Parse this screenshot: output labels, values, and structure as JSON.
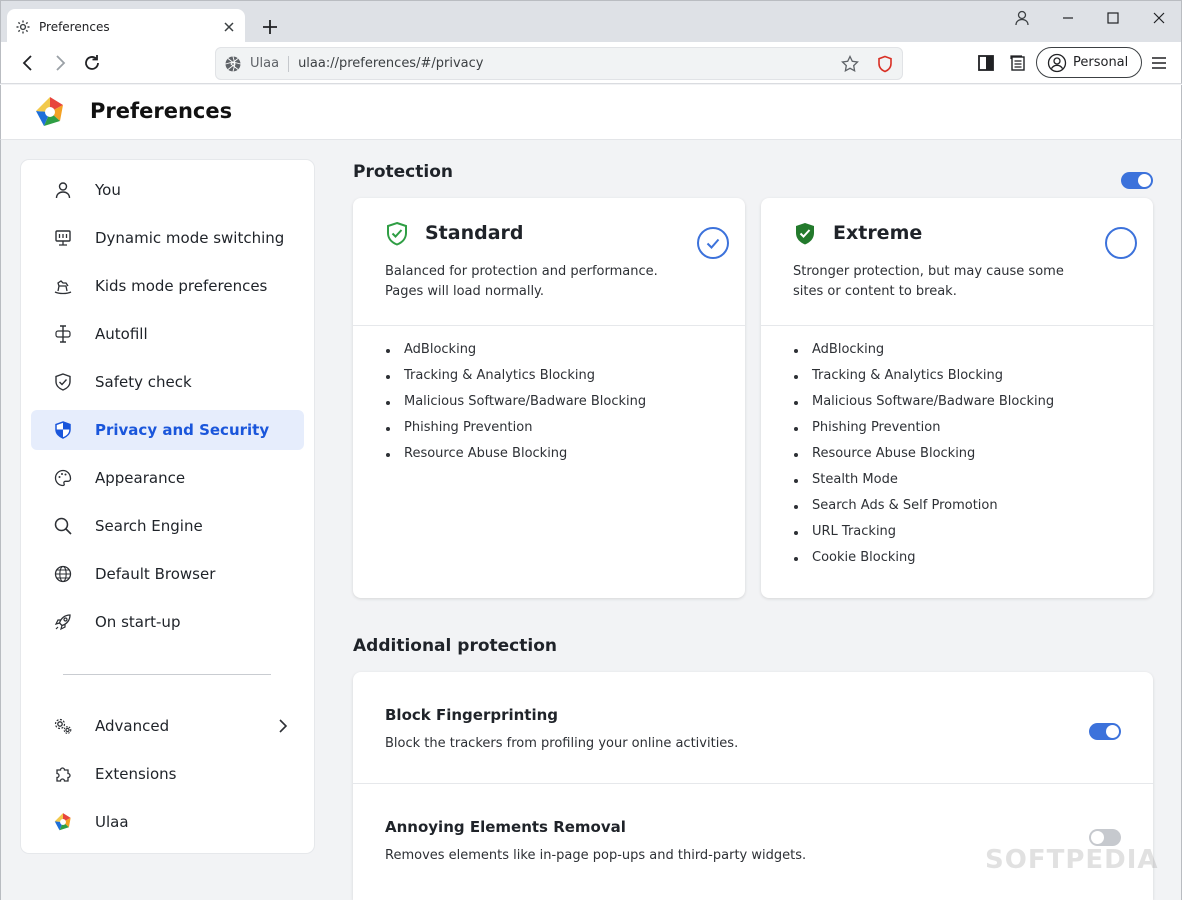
{
  "browser": {
    "tab_title": "Preferences",
    "site_name": "Ulaa",
    "url": "ulaa://preferences/#/privacy",
    "profile_label": "Personal"
  },
  "header": {
    "title": "Preferences"
  },
  "sidebar": {
    "items": [
      {
        "label": "You",
        "icon": "person-icon"
      },
      {
        "label": "Dynamic mode switching",
        "icon": "monitor-icon"
      },
      {
        "label": "Kids mode preferences",
        "icon": "rocking-horse-icon"
      },
      {
        "label": "Autofill",
        "icon": "text-cursor-icon"
      },
      {
        "label": "Safety check",
        "icon": "shield-check-icon"
      },
      {
        "label": "Privacy and Security",
        "icon": "privacy-shield-icon",
        "active": true
      },
      {
        "label": "Appearance",
        "icon": "palette-icon"
      },
      {
        "label": "Search Engine",
        "icon": "search-icon"
      },
      {
        "label": "Default Browser",
        "icon": "globe-icon"
      },
      {
        "label": "On start-up",
        "icon": "rocket-icon"
      }
    ],
    "secondary": [
      {
        "label": "Advanced",
        "icon": "gears-icon"
      },
      {
        "label": "Extensions",
        "icon": "puzzle-icon"
      },
      {
        "label": "Ulaa",
        "icon": "ulaa-logo-icon"
      }
    ]
  },
  "protection": {
    "title": "Protection",
    "enabled": true,
    "plans": [
      {
        "name": "Standard",
        "desc": "Balanced for protection and performance. Pages will load normally.",
        "selected": true,
        "features": [
          "AdBlocking",
          "Tracking & Analytics Blocking",
          "Malicious Software/Badware Blocking",
          "Phishing Prevention",
          "Resource Abuse Blocking"
        ]
      },
      {
        "name": "Extreme",
        "desc": "Stronger protection, but may cause some sites or content to break.",
        "selected": false,
        "features": [
          "AdBlocking",
          "Tracking & Analytics Blocking",
          "Malicious Software/Badware Blocking",
          "Phishing Prevention",
          "Resource Abuse Blocking",
          "Stealth Mode",
          "Search Ads & Self Promotion",
          "URL Tracking",
          "Cookie Blocking"
        ]
      }
    ]
  },
  "additional": {
    "title": "Additional protection",
    "rows": [
      {
        "title": "Block Fingerprinting",
        "desc": "Block the trackers from profiling your online activities.",
        "enabled": true
      },
      {
        "title": "Annoying Elements Removal",
        "desc": "Removes elements like in-page pop-ups and third-party widgets.",
        "enabled": false
      }
    ]
  },
  "watermark": "SOFTPEDIA",
  "colors": {
    "accent": "#3c72db",
    "active_bg": "#e6edfc",
    "standard_shield": "#2f9e44",
    "extreme_shield": "#237a2c"
  }
}
